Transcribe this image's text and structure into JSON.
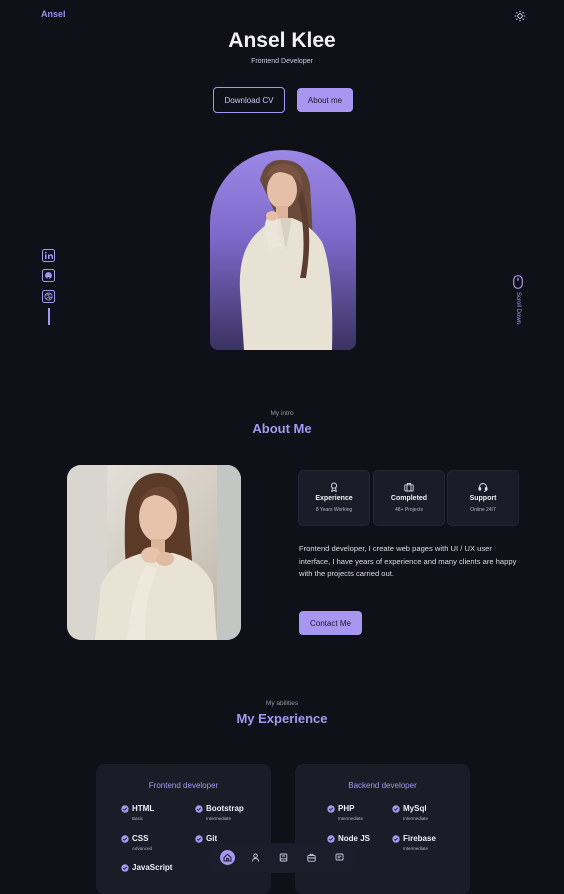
{
  "header": {
    "logo": "Ansel",
    "theme_icon": "sun-icon"
  },
  "hero": {
    "name": "Ansel Klee",
    "role": "Frontend Developer",
    "download_cv": "Download CV",
    "about_me": "About me",
    "scroll_down": "Scroll Down"
  },
  "social": [
    {
      "icon": "linkedin-icon"
    },
    {
      "icon": "github-icon"
    },
    {
      "icon": "dribbble-icon"
    }
  ],
  "about": {
    "subtitle": "My intro",
    "title": "About Me",
    "stats": [
      {
        "icon": "award-icon",
        "title": "Experience",
        "sub": "8 Years Working"
      },
      {
        "icon": "briefcase-icon",
        "title": "Completed",
        "sub": "48+ Projects"
      },
      {
        "icon": "headset-icon",
        "title": "Support",
        "sub": "Online 24/7"
      }
    ],
    "description": "Frontend developer, I create web pages with UI / UX user interface, I have years of experience and many clients are happy with the projects carried out.",
    "contact": "Contact Me"
  },
  "experience": {
    "subtitle": "My abilities",
    "title": "My Experience",
    "frontend": {
      "title": "Frontend developer",
      "skills": [
        {
          "name": "HTML",
          "level": "Basic"
        },
        {
          "name": "Bootstrap",
          "level": "Intermediate"
        },
        {
          "name": "CSS",
          "level": "Advanced"
        },
        {
          "name": "Git",
          "level": ""
        },
        {
          "name": "JavaScript",
          "level": ""
        }
      ]
    },
    "backend": {
      "title": "Backend developer",
      "skills": [
        {
          "name": "PHP",
          "level": "Intermediate"
        },
        {
          "name": "MySql",
          "level": "Intermediate"
        },
        {
          "name": "Node JS",
          "level": ""
        },
        {
          "name": "Firebase",
          "level": "Intermediate"
        }
      ]
    }
  },
  "nav": [
    {
      "icon": "home-icon",
      "active": true
    },
    {
      "icon": "user-icon"
    },
    {
      "icon": "book-icon"
    },
    {
      "icon": "briefcase-icon"
    },
    {
      "icon": "message-icon"
    }
  ],
  "colors": {
    "background": "#0f1018",
    "accent": "#a797f0",
    "card": "#1b1c27"
  }
}
